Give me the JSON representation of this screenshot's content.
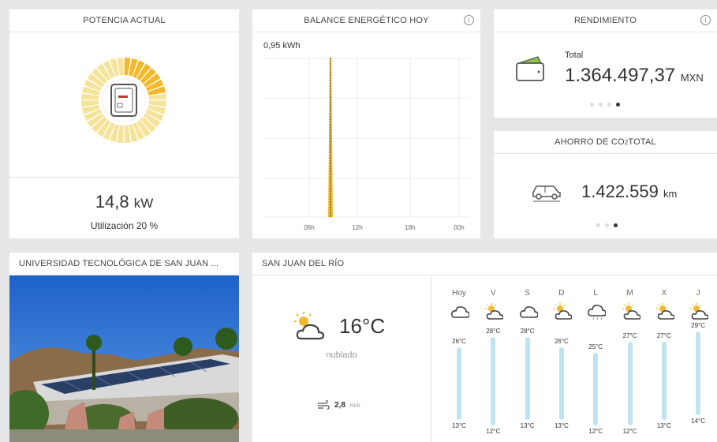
{
  "potencia": {
    "title": "POTENCIA ACTUAL",
    "value": "14,8",
    "unit": "kW",
    "utilization_label": "Utilización 20 %",
    "utilization_percent": 20
  },
  "balance": {
    "title": "BALANCE ENERGÉTICO HOY",
    "info_icon": "info-icon",
    "y_label": "0,95 kWh",
    "x_ticks": [
      "06h",
      "12h",
      "18h",
      "00h"
    ]
  },
  "rendimiento": {
    "title": "RENDIMIENTO",
    "info_icon": "info-icon",
    "total_label": "Total",
    "value": "1.364.497,37",
    "unit": "MXN",
    "page_count": 4,
    "active_page": 4
  },
  "ahorro": {
    "title_pre": "AHORRO DE CO",
    "title_sub": "2",
    "title_post": " TOTAL",
    "value": "1.422.559",
    "unit": "km",
    "page_count": 3,
    "active_page": 3
  },
  "universidad": {
    "title": "UNIVERSIDAD TECNOLÓGICA DE SAN JUAN ..."
  },
  "weather": {
    "title": "SAN JUAN DEL RÍO",
    "current_temp": "16°C",
    "current_desc": "nublado",
    "wind_value": "2,8",
    "wind_unit": "m/s",
    "days": [
      {
        "name": "Hoy",
        "hi": "26°C",
        "lo": "13°C",
        "icon": "cloud-icon"
      },
      {
        "name": "V",
        "hi": "28°C",
        "lo": "12°C",
        "icon": "sun-cloud-icon"
      },
      {
        "name": "S",
        "hi": "28°C",
        "lo": "13°C",
        "icon": "cloud-icon"
      },
      {
        "name": "D",
        "hi": "26°C",
        "lo": "13°C",
        "icon": "sun-cloud-icon"
      },
      {
        "name": "L",
        "hi": "25°C",
        "lo": "12°C",
        "icon": "rain-cloud-icon"
      },
      {
        "name": "M",
        "hi": "27°C",
        "lo": "12°C",
        "icon": "sun-cloud-icon"
      },
      {
        "name": "X",
        "hi": "27°C",
        "lo": "13°C",
        "icon": "sun-cloud-icon"
      },
      {
        "name": "J",
        "hi": "29°C",
        "lo": "14°C",
        "icon": "sun-cloud-icon"
      }
    ]
  },
  "colors": {
    "accent_yellow": "#f2b92c",
    "light_yellow": "#f6e39a",
    "bar_blue": "#bfe3ef",
    "background": "#e6e7e9"
  }
}
